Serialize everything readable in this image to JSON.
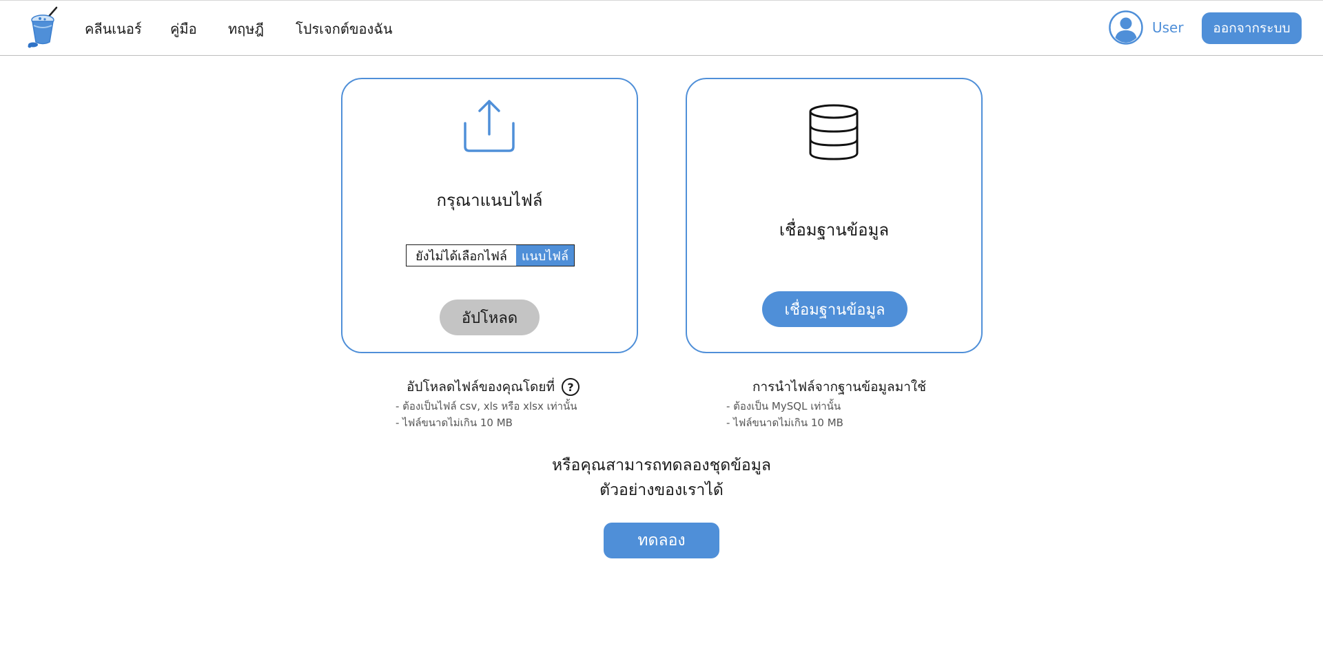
{
  "nav": {
    "links": [
      "คลีนเนอร์",
      "คู่มือ",
      "ทฤษฎี",
      "โปรเจกต์ของฉัน"
    ],
    "user_name": "User",
    "logout_label": "ออกจากระบบ"
  },
  "upload_card": {
    "title": "กรุณาแนบไฟล์",
    "file_status": "ยังไม่ได้เลือกไฟล์",
    "file_button": "แนบไฟล์",
    "upload_button": "อัปโหลด"
  },
  "db_card": {
    "title": "เชื่อมฐานข้อมูล",
    "connect_button": "เชื่อมฐานข้อมูล"
  },
  "upload_info": {
    "title": "อัปโหลดไฟล์ของคุณโดยที่",
    "help_symbol": "?",
    "lines": [
      "- ต้องเป็นไฟล์ csv, xls หรือ xlsx เท่านั้น",
      "- ไฟล์ขนาดไม่เกิน 10 MB"
    ]
  },
  "db_info": {
    "title": "การนำไฟล์จากฐานข้อมูลมาใช้",
    "lines": [
      "- ต้องเป็น MySQL เท่านั้น",
      "- ไฟล์ขนาดไม่เกิน 10 MB"
    ]
  },
  "promo": {
    "line1": "หรือคุณสามารถทดลองชุดข้อมูล",
    "line2": "ตัวอย่างของเราได้",
    "try_button": "ทดลอง"
  },
  "colors": {
    "accent": "#4f8fd8",
    "disabled": "#c4c4c4"
  },
  "icons": {
    "logo": "drink-cup-logo-icon",
    "avatar": "user-avatar-icon",
    "upload": "upload-share-icon",
    "database": "database-icon",
    "help": "question-circle-icon"
  }
}
